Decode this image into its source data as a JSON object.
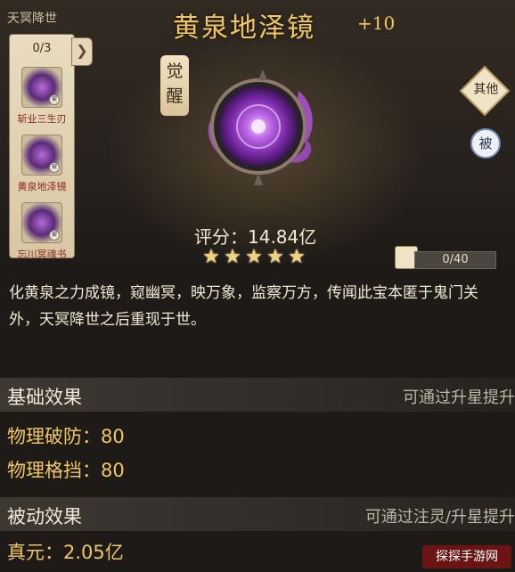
{
  "sidebar": {
    "title": "天冥降世",
    "count": "0/3",
    "items": [
      {
        "label": "斩业三生刃"
      },
      {
        "label": "黄泉地泽镜"
      },
      {
        "label": "忘川冥魂书"
      }
    ],
    "badge_icon": "passive-badge-icon"
  },
  "item": {
    "name": "黄泉地泽镜",
    "level": "+10",
    "awaken_label": "觉醒",
    "others_label": "其他",
    "passive_label": "被",
    "score": "评分：14.84亿",
    "stars": 5,
    "shards": {
      "text": "0/40",
      "progress": 0.0
    },
    "description": "化黄泉之力成镜，窥幽冥，映万象，监察万方，传闻此宝本匿于鬼门关外，天冥降世之后重现于世。"
  },
  "base": {
    "title": "基础效果",
    "note": "可通过升星提升",
    "stats": [
      "物理破防：80",
      "物理格挡：80"
    ]
  },
  "passive": {
    "title": "被动效果",
    "note": "可通过注灵/升星提升",
    "stats": [
      "真元：2.05亿"
    ]
  },
  "watermark": "探探手游网",
  "colors": {
    "title_gold": "#f1c766",
    "mirror_purple": "#9b3fd0"
  }
}
